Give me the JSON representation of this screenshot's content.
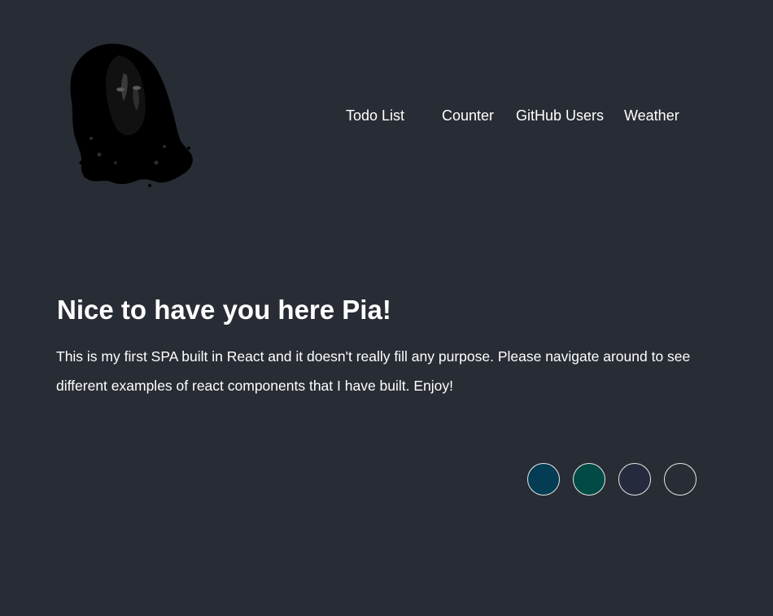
{
  "header": {
    "avatar_icon": "portrait-silhouette-icon"
  },
  "nav": {
    "items": [
      {
        "label": "Todo List"
      },
      {
        "label": "Counter"
      },
      {
        "label": "GitHub Users"
      },
      {
        "label": "Weather"
      }
    ]
  },
  "main": {
    "heading": "Nice to have you here Pia!",
    "intro": "This is my first SPA built in React and it doesn't really fill any purpose. Please navigate around to see different examples of react components that I have built. Enjoy!"
  },
  "theme_swatches": [
    {
      "color": "#043d53"
    },
    {
      "color": "#024a45"
    },
    {
      "color": "#262a3d"
    },
    {
      "color": "#282c34"
    }
  ],
  "colors": {
    "background": "#282c34",
    "text": "#ffffff"
  }
}
